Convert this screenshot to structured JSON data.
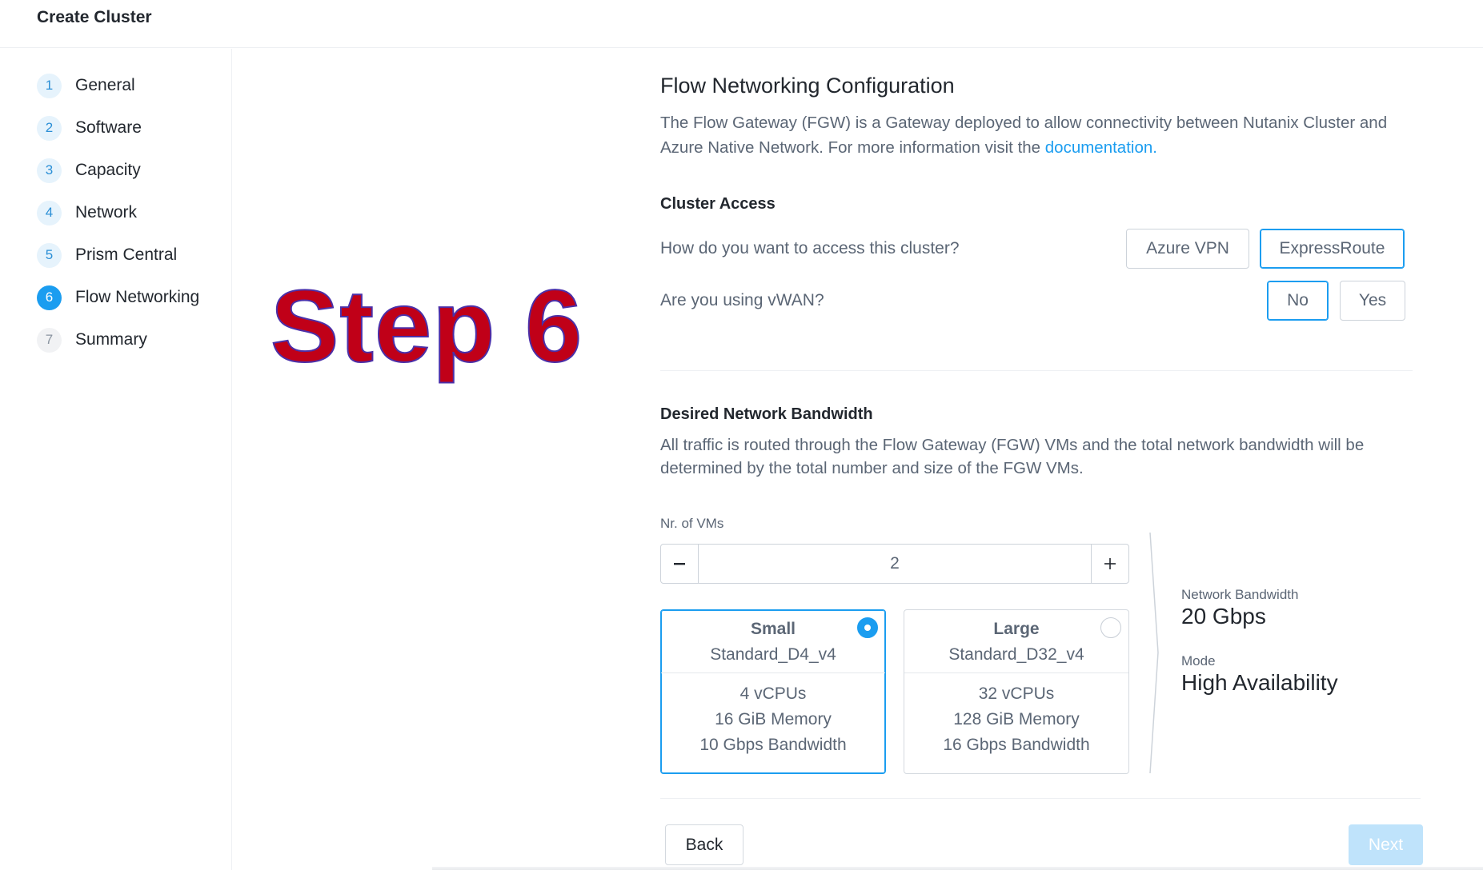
{
  "header": {
    "title": "Create Cluster"
  },
  "sidebar": {
    "steps": [
      {
        "num": "1",
        "label": "General",
        "state": "done"
      },
      {
        "num": "2",
        "label": "Software",
        "state": "done"
      },
      {
        "num": "3",
        "label": "Capacity",
        "state": "done"
      },
      {
        "num": "4",
        "label": "Network",
        "state": "done"
      },
      {
        "num": "5",
        "label": "Prism Central",
        "state": "done"
      },
      {
        "num": "6",
        "label": "Flow Networking",
        "state": "active"
      },
      {
        "num": "7",
        "label": "Summary",
        "state": "pending"
      }
    ]
  },
  "overlay": {
    "text": "Step 6",
    "color": "#c00018"
  },
  "main": {
    "title": "Flow Networking Configuration",
    "description": "The Flow Gateway (FGW) is a Gateway deployed to allow connectivity between Nutanix Cluster and Azure Native Network. For more information visit the",
    "description_link": "documentation.",
    "cluster_access": {
      "title": "Cluster Access",
      "question": "How do you want to access this cluster?",
      "options": [
        "Azure VPN",
        "ExpressRoute"
      ],
      "selected": "ExpressRoute",
      "vwan_question": "Are you using vWAN?",
      "vwan_options": [
        "No",
        "Yes"
      ],
      "vwan_selected": "No"
    },
    "bandwidth": {
      "title": "Desired Network Bandwidth",
      "description": "All traffic is routed through the Flow Gateway (FGW) VMs and the total network bandwidth will be determined by the total number and size of the FGW VMs.",
      "vm_count_label": "Nr. of VMs",
      "vm_count": "2",
      "minus_icon": "minus-icon",
      "plus_icon": "plus-icon",
      "vm_sizes": [
        {
          "name": "Small",
          "type": "Standard_D4_v4",
          "vcpus": "4 vCPUs",
          "memory": "16 GiB Memory",
          "bandwidth": "10 Gbps Bandwidth",
          "selected": true
        },
        {
          "name": "Large",
          "type": "Standard_D32_v4",
          "vcpus": "32 vCPUs",
          "memory": "128 GiB Memory",
          "bandwidth": "16 Gbps Bandwidth",
          "selected": false
        }
      ],
      "summary": {
        "bandwidth_label": "Network Bandwidth",
        "bandwidth_value": "20 Gbps",
        "mode_label": "Mode",
        "mode_value": "High Availability"
      }
    },
    "footer": {
      "back_label": "Back",
      "next_label": "Next"
    }
  },
  "colors": {
    "accent": "#1b9df0",
    "accent_light": "#e6f3fc",
    "next_disabled": "#bfe3fb"
  }
}
